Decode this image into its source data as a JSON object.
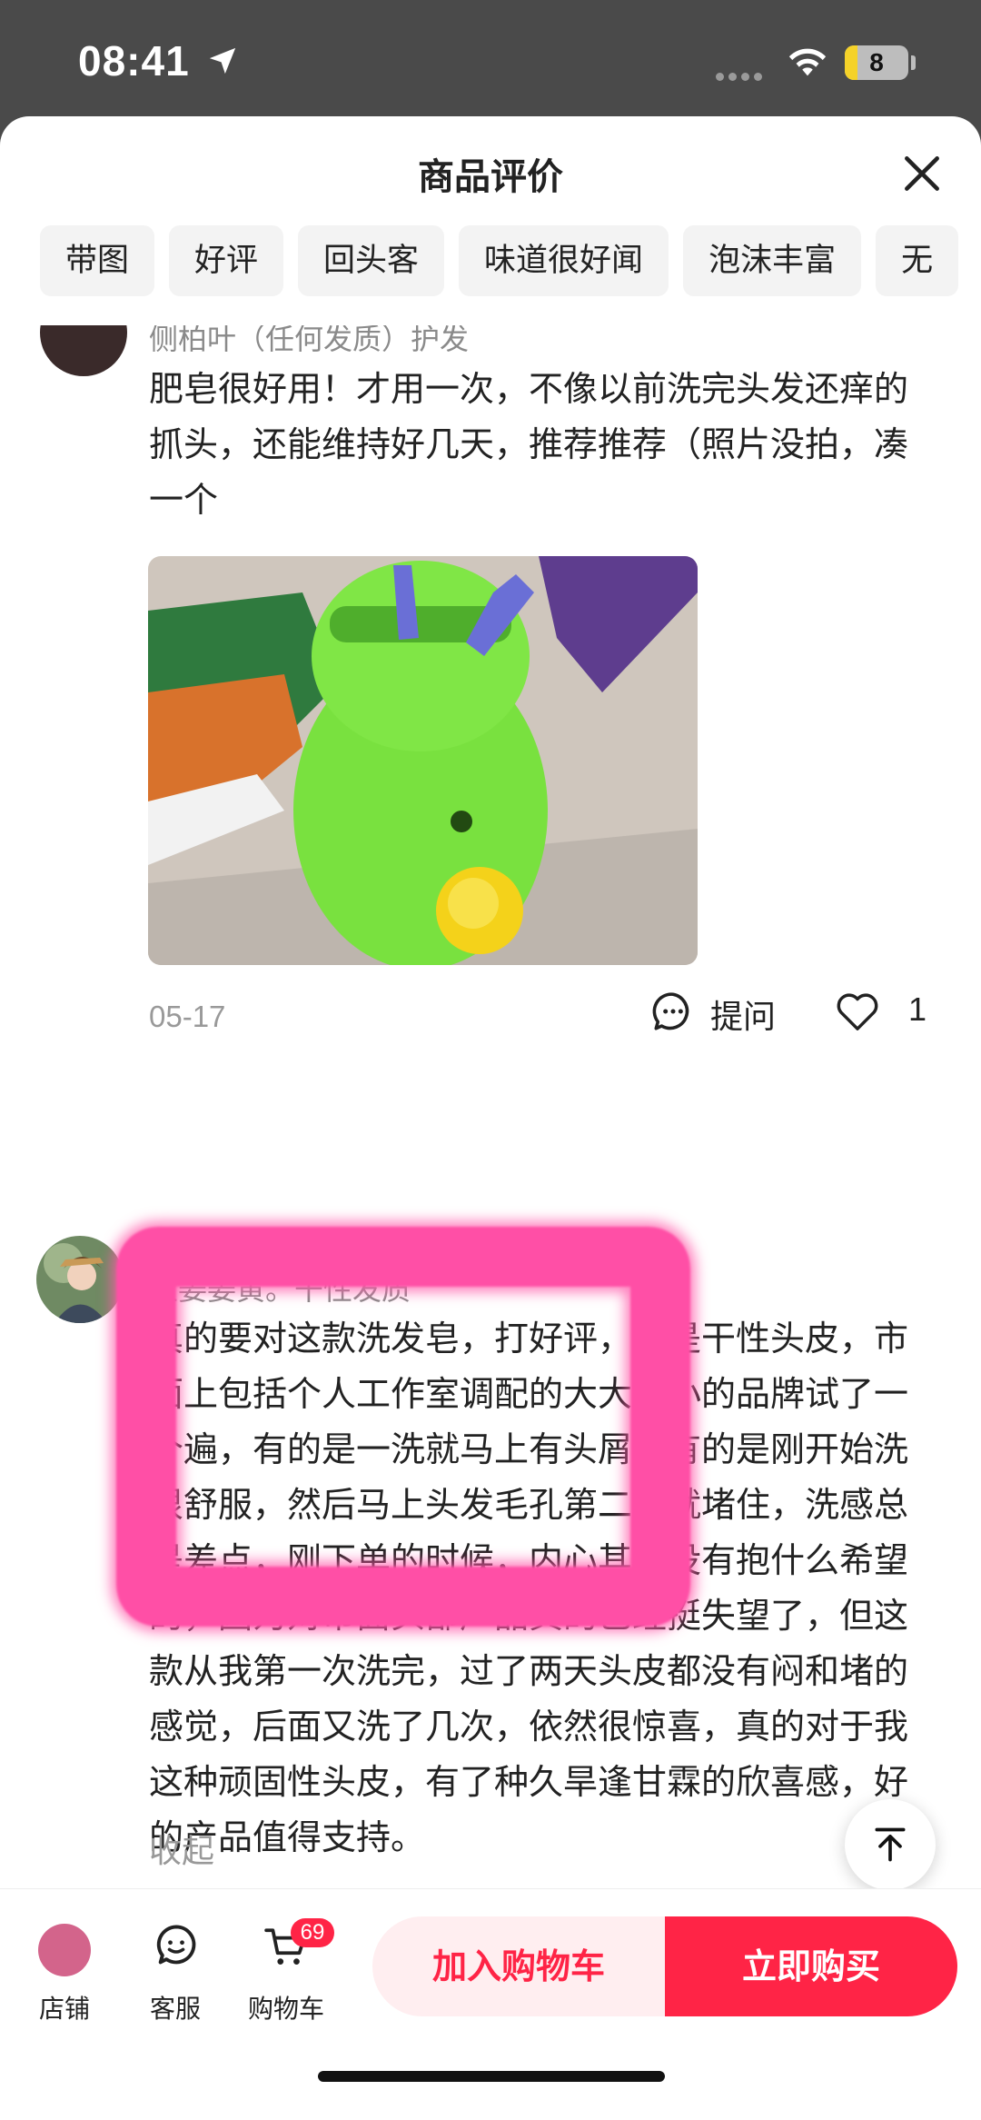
{
  "status_bar": {
    "time": "08:41",
    "battery": "8"
  },
  "header": {
    "title": "商品评价"
  },
  "filters": [
    "带图",
    "好评",
    "回头客",
    "味道很好闻",
    "泡沫丰富",
    "无"
  ],
  "review1": {
    "name": "侧柏叶（任何发质）护发",
    "text": "肥皂很好用！才用一次，不像以前洗完头发还痒的抓头，还能维持好几天，推荐推荐（照片没拍，凑一个",
    "date": "05-17",
    "ask_label": "提问",
    "likes": "1"
  },
  "review2": {
    "name": "生姜姜黄。干性发质",
    "text": "真的要对这款洗发皂，打好评，我是干性头皮，市面上包括个人工作室调配的大大小小的品牌试了一个遍，有的是一洗就马上有头屑，有的是刚开始洗很舒服，然后马上头发毛孔第二天就堵住，洗感总是差点，刚下单的时候，内心其实没有抱什么希望的，因为对市面头部产品真的已经挺失望了，但这款从我第一次洗完，过了两天头皮都没有闷和堵的感觉，后面又洗了几次，依然很惊喜，真的对于我这种顽固性头皮，有了种久旱逢甘霖的欣喜感，好的产品值得支持。",
    "collapse": "收起"
  },
  "bottom_bar": {
    "shop": "店铺",
    "service": "客服",
    "cart": "购物车",
    "cart_count": "69",
    "add_to_cart": "加入购物车",
    "buy_now": "立即购买"
  },
  "colors": {
    "accent": "#ff2446",
    "highlight": "#ff4fa6"
  }
}
